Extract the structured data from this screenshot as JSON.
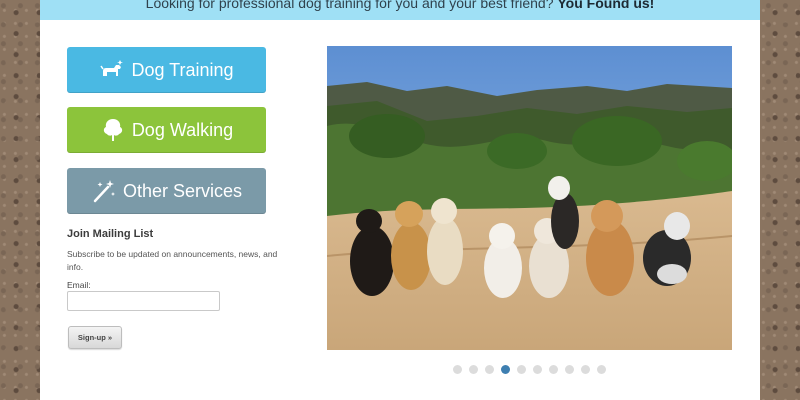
{
  "banner": {
    "text": "Looking for professional dog training for you and your best friend?",
    "highlight": "You Found us!"
  },
  "services": {
    "training": {
      "label": "Dog Training",
      "icon": "dog-icon",
      "color": "#4ab9e3"
    },
    "walking": {
      "label": "Dog Walking",
      "icon": "tree-icon",
      "color": "#8cc43b"
    },
    "other": {
      "label": "Other Services",
      "icon": "magic-wand-icon",
      "color": "#7b9aa8"
    }
  },
  "mailing": {
    "title": "Join Mailing List",
    "description": "Subscribe to be updated on announcements, news, and info.",
    "email_label": "Email:",
    "email_value": "",
    "signup_label": "Sign-up »"
  },
  "slideshow": {
    "image": "photo of dogs sitting on a dirt trail in the hills",
    "dot_count": 10,
    "active_index": 3,
    "active_color": "#3e7fb1"
  }
}
